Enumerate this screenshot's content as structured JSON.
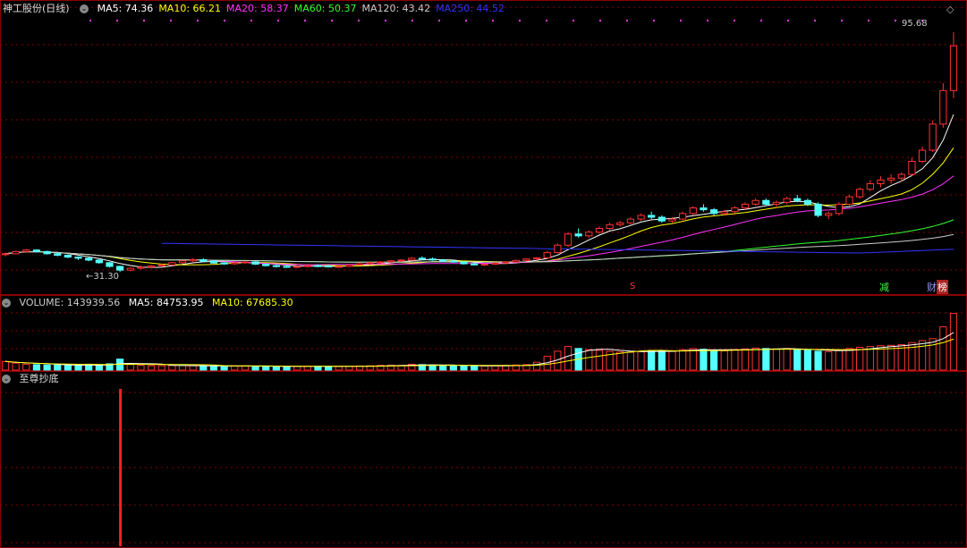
{
  "stock": {
    "name": "神工股份(日线)"
  },
  "price_panel": {
    "ma": [
      {
        "label": "MA5: 74.36",
        "color": "#ffffff"
      },
      {
        "label": "MA10: 66.21",
        "color": "#ffff00"
      },
      {
        "label": "MA20: 58.37",
        "color": "#ff33ff"
      },
      {
        "label": "MA60: 50.37",
        "color": "#33ff33"
      },
      {
        "label": "MA120: 43.42",
        "color": "#cccccc"
      },
      {
        "label": "MA250: 44.52",
        "color": "#3333ff"
      }
    ],
    "high_label": "95.68",
    "low_label": "31.30",
    "markers": {
      "s": "S",
      "reduce": "减",
      "list": "榜",
      "fin": "财"
    }
  },
  "volume_panel": {
    "volume": "VOLUME: 143939.56",
    "ma5": "MA5: 84753.95",
    "ma10": "MA10: 67685.30"
  },
  "indicator_panel": {
    "title": "至尊抄底"
  },
  "colors": {
    "up": "#ff3232",
    "down": "#54ffff",
    "grid": "#8b0000"
  },
  "chart_data": {
    "type": "candlestick",
    "title": "神工股份(日线)",
    "price_high": 95.68,
    "price_low": 31.3,
    "ohlc": [
      [
        36,
        36.5,
        35.5,
        36.2
      ],
      [
        36.2,
        37,
        36,
        36.8
      ],
      [
        36.8,
        37.5,
        36.5,
        37.2
      ],
      [
        37.2,
        37.4,
        36.5,
        36.8
      ],
      [
        36.8,
        37,
        36,
        36.2
      ],
      [
        36.2,
        36.5,
        35.5,
        35.8
      ],
      [
        35.8,
        36,
        35,
        35.3
      ],
      [
        35.3,
        35.5,
        34.5,
        35
      ],
      [
        35,
        35.2,
        34.2,
        34.5
      ],
      [
        34.5,
        34.7,
        33.5,
        33.8
      ],
      [
        33.8,
        34,
        32.5,
        32.8
      ],
      [
        32.8,
        33,
        31.3,
        31.8
      ],
      [
        31.8,
        32.5,
        31.5,
        32.3
      ],
      [
        32.3,
        33,
        32,
        32.6
      ],
      [
        32.6,
        33.2,
        32.3,
        32.9
      ],
      [
        32.9,
        33.5,
        32.6,
        33.2
      ],
      [
        33.2,
        34,
        33,
        33.8
      ],
      [
        33.8,
        34.5,
        33.5,
        34.3
      ],
      [
        34.3,
        35,
        34,
        34.6
      ],
      [
        34.6,
        35,
        34,
        34.2
      ],
      [
        34.2,
        34.5,
        33.5,
        33.7
      ],
      [
        33.7,
        34,
        33.2,
        33.5
      ],
      [
        33.5,
        34,
        33.2,
        33.8
      ],
      [
        33.8,
        34.3,
        33.5,
        34
      ],
      [
        34,
        34.2,
        33.2,
        33.4
      ],
      [
        33.4,
        33.6,
        32.8,
        33
      ],
      [
        33,
        33.3,
        32.5,
        32.8
      ],
      [
        32.8,
        33.2,
        32.4,
        32.6
      ],
      [
        32.6,
        33,
        32.3,
        32.8
      ],
      [
        32.8,
        33.3,
        32.5,
        33
      ],
      [
        33,
        33.4,
        32.6,
        32.9
      ],
      [
        32.9,
        33.2,
        32.5,
        32.7
      ],
      [
        32.7,
        33,
        32.4,
        32.8
      ],
      [
        32.8,
        33.4,
        32.6,
        33.2
      ],
      [
        33.2,
        33.8,
        33,
        33.5
      ],
      [
        33.5,
        34,
        33.2,
        33.8
      ],
      [
        33.8,
        34.2,
        33.5,
        34
      ],
      [
        34,
        34.5,
        33.7,
        34.3
      ],
      [
        34.3,
        34.8,
        34,
        34.5
      ],
      [
        34.5,
        35.3,
        34.3,
        35
      ],
      [
        35,
        35.5,
        34.5,
        34.8
      ],
      [
        34.8,
        35.2,
        34.3,
        34.5
      ],
      [
        34.5,
        34.8,
        34,
        34.2
      ],
      [
        34.2,
        34.6,
        33.8,
        34
      ],
      [
        34,
        34.3,
        33.3,
        33.5
      ],
      [
        33.5,
        33.8,
        33,
        33.2
      ],
      [
        33.2,
        33.6,
        32.9,
        33.4
      ],
      [
        33.4,
        33.9,
        33.2,
        33.7
      ],
      [
        33.7,
        34.2,
        33.5,
        34
      ],
      [
        34,
        34.6,
        33.8,
        34.4
      ],
      [
        34.4,
        35,
        34.2,
        34.8
      ],
      [
        34.8,
        35.3,
        34.5,
        35.1
      ],
      [
        35.1,
        37,
        35,
        36.5
      ],
      [
        36.5,
        39,
        36.3,
        38.5
      ],
      [
        38.5,
        42,
        38,
        41.5
      ],
      [
        41.5,
        43,
        40.5,
        41
      ],
      [
        41,
        42.5,
        40.5,
        42
      ],
      [
        42,
        43.5,
        41.5,
        43
      ],
      [
        43,
        44.5,
        42.5,
        44
      ],
      [
        44,
        45,
        43.5,
        44.5
      ],
      [
        44.5,
        46,
        44,
        45.5
      ],
      [
        45.5,
        47,
        45,
        46.5
      ],
      [
        46.5,
        47.5,
        45.5,
        46
      ],
      [
        46,
        46.5,
        44.5,
        45
      ],
      [
        45,
        46,
        44.5,
        45.5
      ],
      [
        45.5,
        47.5,
        45.2,
        47
      ],
      [
        47,
        49,
        46.5,
        48.5
      ],
      [
        48.5,
        49.5,
        47.5,
        48
      ],
      [
        48,
        48.5,
        46.5,
        47
      ],
      [
        47,
        48,
        46.5,
        47.5
      ],
      [
        47.5,
        49,
        47,
        48.5
      ],
      [
        48.5,
        50,
        48,
        49.5
      ],
      [
        49.5,
        51,
        49,
        50.5
      ],
      [
        50.5,
        51,
        49,
        49.5
      ],
      [
        49.5,
        50.5,
        48.5,
        50
      ],
      [
        50,
        51.5,
        49.5,
        51
      ],
      [
        51,
        52,
        50,
        50.5
      ],
      [
        50.5,
        51,
        49,
        49.5
      ],
      [
        49.5,
        50,
        46,
        46.5
      ],
      [
        46.5,
        47.5,
        45.5,
        47
      ],
      [
        47,
        50,
        46.5,
        49.5
      ],
      [
        49.5,
        52,
        49,
        51.5
      ],
      [
        51.5,
        54,
        51,
        53.5
      ],
      [
        53.5,
        56,
        53,
        55
      ],
      [
        55,
        57,
        54,
        56
      ],
      [
        56,
        57.5,
        55,
        56.5
      ],
      [
        56.5,
        58,
        55.5,
        57.5
      ],
      [
        57.5,
        62,
        57,
        61
      ],
      [
        61,
        65,
        60.5,
        64
      ],
      [
        64,
        72,
        63.5,
        71
      ],
      [
        71,
        82,
        70,
        80
      ],
      [
        80,
        95.68,
        78,
        92
      ]
    ],
    "volume": [
      22000,
      18000,
      15000,
      14000,
      13000,
      12500,
      12000,
      11000,
      15000,
      12000,
      16000,
      28000,
      14000,
      12000,
      11000,
      11000,
      12000,
      11500,
      11000,
      10500,
      10000,
      10000,
      10500,
      11000,
      10000,
      9500,
      9000,
      9000,
      9500,
      10000,
      10000,
      9500,
      9000,
      9500,
      10500,
      11000,
      12000,
      12500,
      12000,
      15000,
      14000,
      13000,
      12000,
      11000,
      10500,
      10000,
      10500,
      11000,
      12000,
      13000,
      14000,
      20000,
      35000,
      48000,
      60000,
      55000,
      52000,
      50000,
      48000,
      46000,
      45000,
      47000,
      50000,
      49000,
      48000,
      52000,
      55000,
      53000,
      50000,
      49000,
      52000,
      54000,
      56000,
      55000,
      53000,
      55000,
      52000,
      50000,
      48000,
      47000,
      50000,
      55000,
      58000,
      60000,
      62000,
      63000,
      65000,
      70000,
      75000,
      80000,
      110000,
      143939.56
    ]
  }
}
